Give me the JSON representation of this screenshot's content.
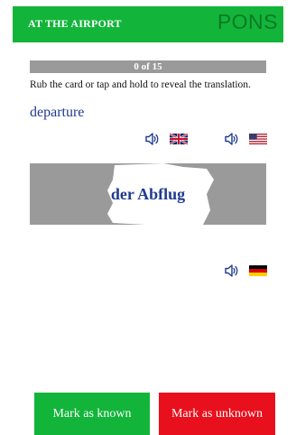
{
  "header": {
    "title": "AT THE AIRPORT",
    "logo": "PONS",
    "bg_color": "#12b53a"
  },
  "progress": {
    "text": "0 of 15",
    "current": 0,
    "total": 15
  },
  "instruction": "Rub the card or tap and hold to reveal the translation.",
  "word": "departure",
  "audio": [
    {
      "icon": "speaker-icon",
      "flag": "uk-flag-icon"
    },
    {
      "icon": "speaker-icon",
      "flag": "us-flag-icon"
    },
    {
      "icon": "speaker-icon",
      "flag": "german-flag-icon"
    }
  ],
  "card": {
    "translation": "der Abflug",
    "cover_color": "#9a9a9a"
  },
  "buttons": {
    "known_label": "Mark as known",
    "known_color": "#12b53a",
    "unknown_label": "Mark as unknown",
    "unknown_color": "#e8101c"
  }
}
